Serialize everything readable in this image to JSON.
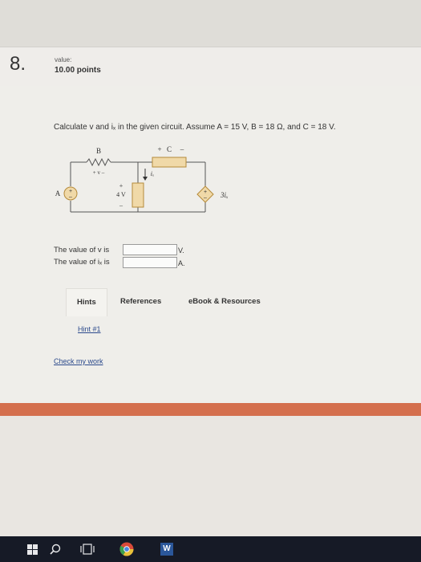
{
  "question_header": {
    "number": "8.",
    "value_label": "value:",
    "points": "10.00 points"
  },
  "question": {
    "text": "Calculate v and iₓ in the given circuit. Assume A = 15 V, B = 18 Ω, and C = 18 V."
  },
  "circuit": {
    "label_B": "B",
    "label_C_plus": "+",
    "label_C": "C",
    "label_C_minus": "–",
    "label_v": "+ v –",
    "label_ix": "iₓ",
    "label_plus_4v": "+",
    "label_4v": "4 V",
    "label_minus_4v": "–",
    "label_A": "A",
    "source_A_plus": "+",
    "source_A_minus": "–",
    "dep_plus": "+",
    "dep_minus": "–",
    "label_dep": "3iₓ"
  },
  "answers": [
    {
      "label": "The value of v is",
      "value": "",
      "unit": "V."
    },
    {
      "label": "The value of iₓ is",
      "value": "",
      "unit": "A."
    }
  ],
  "tabs": [
    {
      "label": "Hints"
    },
    {
      "label": "References"
    },
    {
      "label": "eBook & Resources"
    }
  ],
  "hint_link": "Hint #1",
  "check_link": "Check my work",
  "taskbar": {
    "items": [
      "windows-logo-icon",
      "search-icon",
      "task-view-icon",
      "chrome-icon",
      "word-icon"
    ],
    "word_letter": "W"
  },
  "colors": {
    "accent_bar": "#d46f4d",
    "taskbar": "#161a26",
    "link": "#2c4a8c",
    "component_fill": "#f0d9a8",
    "component_stroke": "#b58a3a"
  }
}
